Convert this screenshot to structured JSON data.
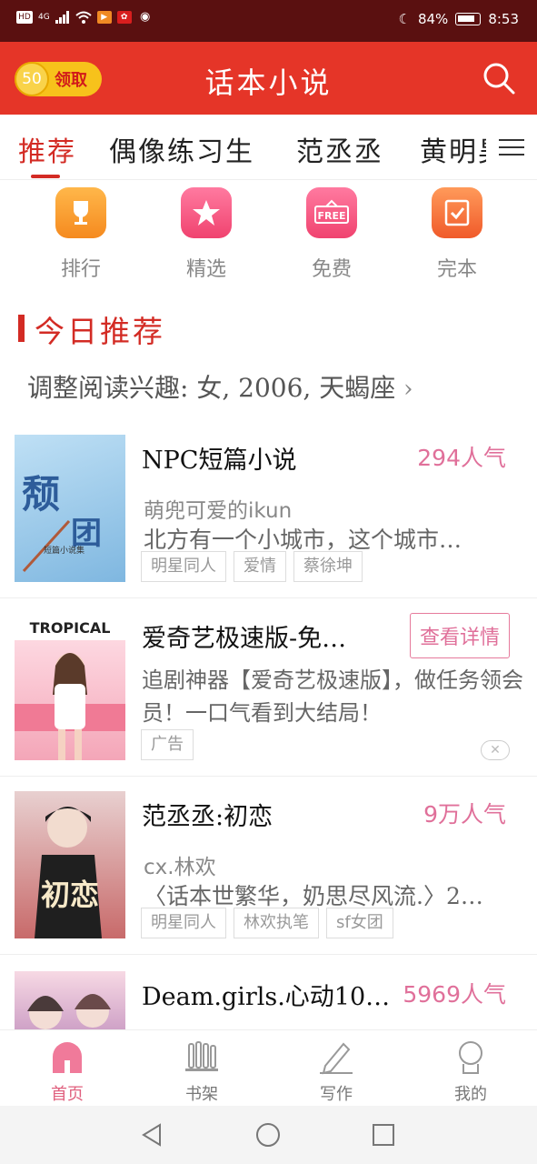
{
  "status_bar": {
    "left_text": "HD 4G",
    "battery": "84%",
    "time": "8:53"
  },
  "header": {
    "coin_count": "50",
    "coin_label": "领取",
    "title": "话本小说",
    "search_icon": "search-icon"
  },
  "tabs": [
    {
      "label": "推荐",
      "active": true
    },
    {
      "label": "偶像练习生",
      "active": false
    },
    {
      "label": "范丞丞",
      "active": false
    },
    {
      "label": "黄明昊",
      "active": false
    }
  ],
  "categories": [
    {
      "label": "排行",
      "icon": "trophy-icon",
      "color": "#f59a2f"
    },
    {
      "label": "精选",
      "icon": "star-icon",
      "color": "#f5527e"
    },
    {
      "label": "免费",
      "icon": "free-tag-icon",
      "color": "#f5527e"
    },
    {
      "label": "完本",
      "icon": "check-book-icon",
      "color": "#f56a3a"
    }
  ],
  "section": {
    "title": "今日推荐",
    "interest_text": "调整阅读兴趣: 女, 2006, 天蝎座",
    "chevron": "›"
  },
  "items": [
    {
      "title": "NPC短篇小说",
      "popularity": "294人气",
      "author": "萌兜可爱的ikun",
      "desc": "北方有一个小城市，这个城市…",
      "tags": [
        "明星同人",
        "爱情",
        "蔡徐坤"
      ],
      "cover_text": "短篇小说集"
    },
    {
      "ad": true,
      "title": "爱奇艺极速版-免…",
      "button": "查看详情",
      "desc": "追剧神器【爱奇艺极速版】，做任务领会员！一口气看到大结局！",
      "tags": [
        "广告"
      ],
      "cover_text": "TROPICAL",
      "close": "✕"
    },
    {
      "title": "范丞丞:初恋",
      "popularity": "9万人气",
      "author": "cx.林欢",
      "desc": "〈话本世繁华，奶思尽风流.〉2…",
      "tags": [
        "明星同人",
        "林欢执笔",
        "sf女团"
      ],
      "cover_text": "初恋"
    },
    {
      "title": "Deam.girls.心动10…",
      "popularity": "5969人气"
    }
  ],
  "bottom_nav": [
    {
      "label": "首页",
      "icon": "home-icon",
      "active": true
    },
    {
      "label": "书架",
      "icon": "bookshelf-icon",
      "active": false
    },
    {
      "label": "写作",
      "icon": "pen-icon",
      "active": false
    },
    {
      "label": "我的",
      "icon": "profile-icon",
      "active": false
    }
  ],
  "colors": {
    "brand_red": "#e53528",
    "accent_pink": "#e0709a",
    "active_tab": "#d32b24"
  }
}
